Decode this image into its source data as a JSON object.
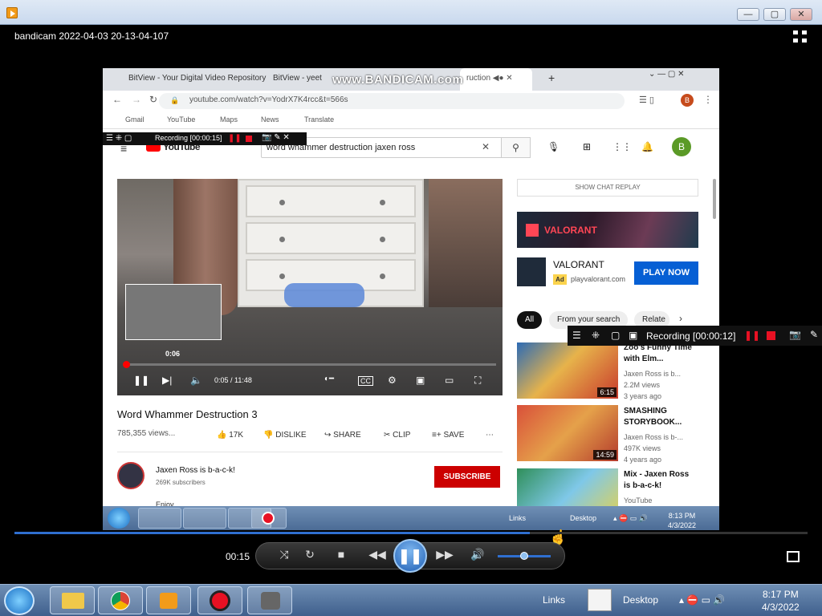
{
  "window": {
    "title": "bandicam 2022-04-03 20-13-04-107",
    "min": "—",
    "max": "▢",
    "close": "✕"
  },
  "browser": {
    "tabs": [
      "BitView - Your Digital Video Repository",
      "BitView - yeet",
      "Word Whammer Destruction"
    ],
    "watermark": "www.BANDICAM.com",
    "url": "youtube.com/watch?v=YodrX7K4rcc&t=566s",
    "profile_initial": "B",
    "bookmarks": [
      "Gmail",
      "YouTube",
      "Maps",
      "News",
      "Translate"
    ]
  },
  "youtube": {
    "logo": "YouTube",
    "search_query": "word whammer destruction jaxen ross",
    "avatar": "B",
    "player": {
      "thumb_time": "0:06",
      "time": "0:05 / 11:48",
      "progress": 0.007
    },
    "video_title": "Word Whammer Destruction 3",
    "views": "785,355 views...",
    "actions": {
      "like": "17K",
      "dislike": "DISLIKE",
      "share": "SHARE",
      "clip": "CLIP",
      "save": "SAVE"
    },
    "channel": {
      "name": "Jaxen Ross is b-a-c-k!",
      "subs": "269K subscribers",
      "subscribe": "SUBSCRIBE",
      "desc": "Enjoy."
    },
    "chat_replay": "SHOW CHAT REPLAY",
    "ad": {
      "brand": "VALORANT",
      "title": "VALORANT",
      "badge": "Ad",
      "url": "playvalorant.com",
      "cta": "PLAY NOW"
    },
    "chips": [
      "All",
      "From your search",
      "Relate"
    ],
    "recommendations": [
      {
        "title": "Zoo's Funny Time with Elm...",
        "channel": "Jaxen Ross is b...",
        "views": "2.2M views",
        "age": "3 years ago",
        "duration": "6:15"
      },
      {
        "title": "SMASHING STORYBOOK...",
        "channel": "Jaxen Ross is b-...",
        "views": "497K views",
        "age": "4 years ago",
        "duration": "14:59"
      },
      {
        "title": "Mix - Jaxen Ross is b-a-c-k!",
        "channel": "YouTube",
        "views": "",
        "age": "",
        "duration": ""
      }
    ]
  },
  "recording_small": {
    "label": "Recording [00:00:15]"
  },
  "recording_large": {
    "label": "Recording [00:00:12]"
  },
  "inner_taskbar": {
    "links": "Links",
    "desktop": "Desktop",
    "time": "8:13 PM",
    "date": "4/3/2022"
  },
  "player_controls": {
    "current_time": "00:15",
    "seek_progress": 0.65,
    "volume": 0.5
  },
  "taskbar": {
    "links": "Links",
    "desktop": "Desktop",
    "time": "8:17 PM",
    "date": "4/3/2022"
  }
}
